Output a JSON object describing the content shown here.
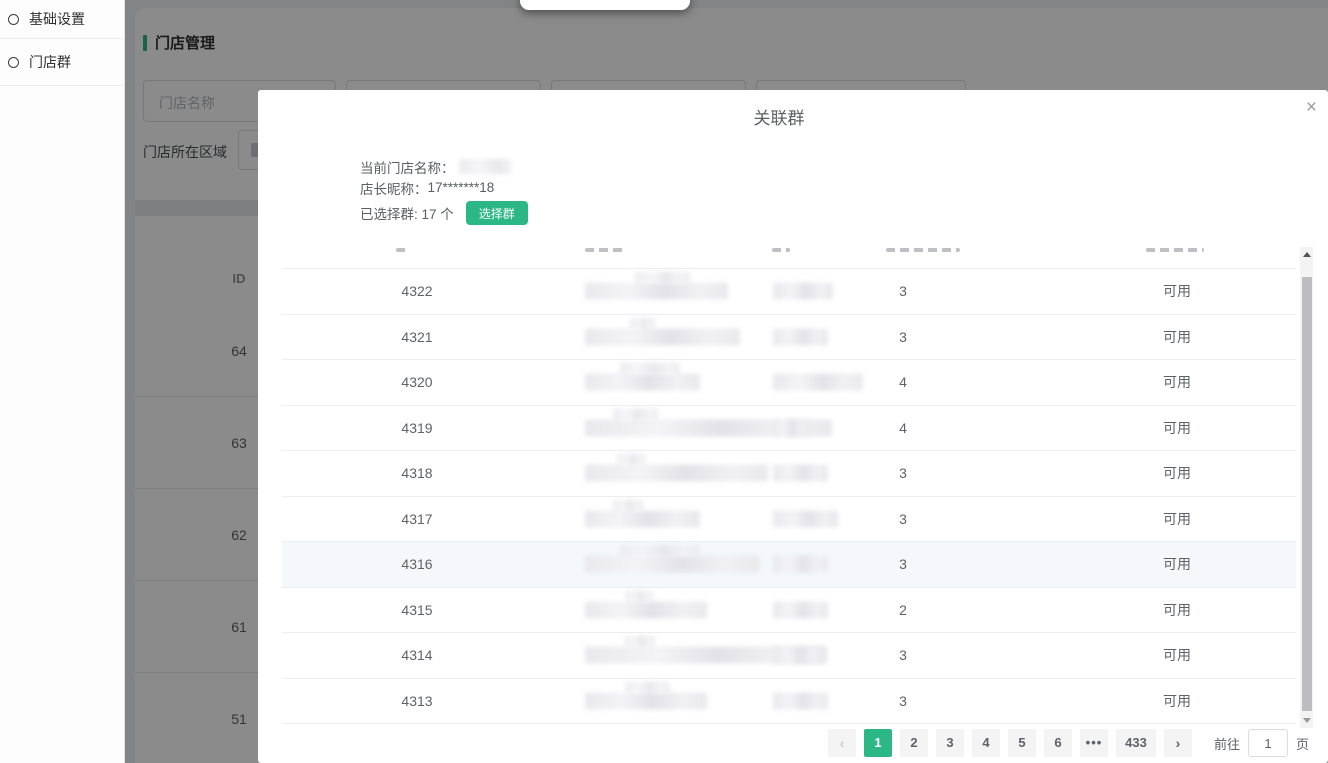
{
  "colors": {
    "accent_green": "#2bb886",
    "dim_overlay": "rgba(0,0,0,0.455)"
  },
  "sidebar": {
    "items": [
      {
        "icon": "circle",
        "label": "基础设置"
      },
      {
        "icon": "circle",
        "label": "门店群"
      }
    ]
  },
  "page": {
    "title": "门店管理",
    "store_name_placeholder": "门店名称",
    "region_label": "门店所在区域",
    "table": {
      "id_header": "ID",
      "row_ids": [
        "64",
        "63",
        "62",
        "61",
        "51"
      ]
    }
  },
  "modal": {
    "title": "关联群",
    "close_icon": "×",
    "info": {
      "store_label": "当前门店名称：",
      "manager_label": "店长昵称：",
      "manager_value": "17*******18",
      "selected_label": "已选择群: 17 个",
      "select_button": "选择群"
    },
    "table": {
      "rows": [
        {
          "id": "4322",
          "members": "3",
          "status": "可用",
          "name_w": 143,
          "tail_dx": 50,
          "tail_w": 55,
          "owner_w": 60,
          "highlight": false
        },
        {
          "id": "4321",
          "members": "3",
          "status": "可用",
          "name_w": 155,
          "tail_dx": 45,
          "tail_w": 25,
          "owner_w": 55,
          "highlight": false
        },
        {
          "id": "4320",
          "members": "4",
          "status": "可用",
          "name_w": 115,
          "tail_dx": 35,
          "tail_w": 60,
          "owner_w": 90,
          "highlight": false
        },
        {
          "id": "4319",
          "members": "4",
          "status": "可用",
          "name_w": 247,
          "tail_dx": 28,
          "tail_w": 45,
          "owner_w": 35,
          "highlight": false
        },
        {
          "id": "4318",
          "members": "3",
          "status": "可用",
          "name_w": 183,
          "tail_dx": 32,
          "tail_w": 28,
          "owner_w": 55,
          "highlight": false
        },
        {
          "id": "4317",
          "members": "3",
          "status": "可用",
          "name_w": 115,
          "tail_dx": 28,
          "tail_w": 30,
          "owner_w": 65,
          "highlight": false
        },
        {
          "id": "4316",
          "members": "3",
          "status": "可用",
          "name_w": 175,
          "tail_dx": 35,
          "tail_w": 80,
          "owner_w": 55,
          "highlight": true
        },
        {
          "id": "4315",
          "members": "2",
          "status": "可用",
          "name_w": 122,
          "tail_dx": 40,
          "tail_w": 28,
          "owner_w": 55,
          "highlight": false
        },
        {
          "id": "4314",
          "members": "3",
          "status": "可用",
          "name_w": 242,
          "tail_dx": 40,
          "tail_w": 30,
          "owner_w": 50,
          "highlight": false
        },
        {
          "id": "4313",
          "members": "3",
          "status": "可用",
          "name_w": 122,
          "tail_dx": 40,
          "tail_w": 45,
          "owner_w": 55,
          "highlight": false
        }
      ]
    },
    "pagination": {
      "prev": "‹",
      "next": "›",
      "pages": [
        "1",
        "2",
        "3",
        "4",
        "5",
        "6"
      ],
      "ellipsis": "•••",
      "last_page": "433",
      "active_page": "1",
      "goto_label": "前往",
      "goto_value": "1",
      "page_unit": "页"
    }
  }
}
